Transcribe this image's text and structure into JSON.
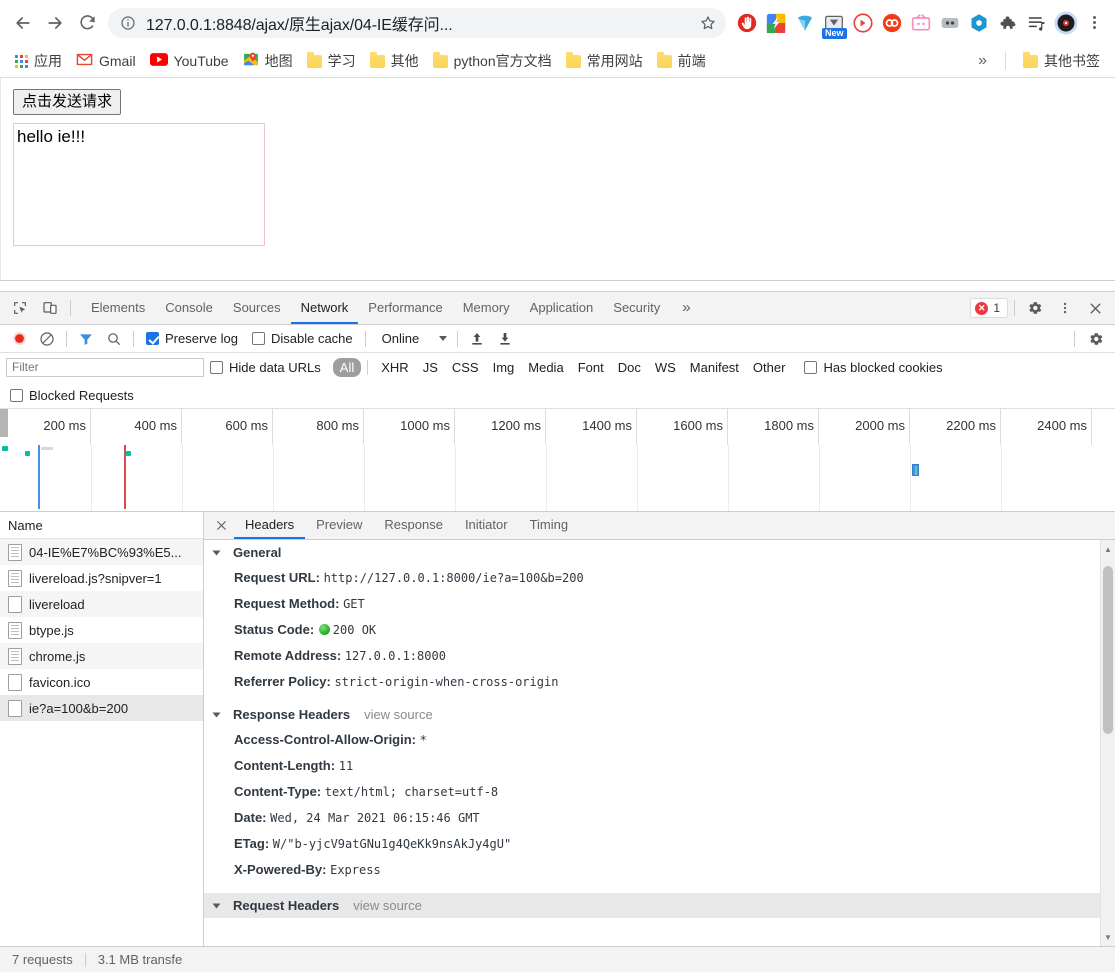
{
  "browser": {
    "url": "127.0.0.1:8848/ajax/原生ajax/04-IE缓存问...",
    "back_icon": "back-arrow-icon",
    "forward_icon": "forward-arrow-icon",
    "reload_icon": "reload-icon",
    "info_icon": "site-info-icon",
    "star_icon": "bookmark-star-icon",
    "menu_icon": "chrome-menu-icon",
    "extensions": [
      {
        "name": "adblock-extension-icon",
        "badge": ""
      },
      {
        "name": "screenshot-extension-icon",
        "badge": ""
      },
      {
        "name": "yandex-extension-icon",
        "badge": ""
      },
      {
        "name": "video-downloader-extension-icon",
        "badge": "New"
      },
      {
        "name": "media-player-extension-icon",
        "badge": ""
      },
      {
        "name": "infinity-newtab-extension-icon",
        "badge": ""
      },
      {
        "name": "tv-extension-icon",
        "badge": ""
      },
      {
        "name": "tampermonkey-extension-icon",
        "badge": ""
      },
      {
        "name": "octotree-extension-icon",
        "badge": ""
      },
      {
        "name": "puzzle-extensions-icon",
        "badge": ""
      },
      {
        "name": "playlist-extension-icon",
        "badge": ""
      },
      {
        "name": "music-extension-icon",
        "badge": ""
      }
    ]
  },
  "bookmarks": {
    "apps_label": "应用",
    "items": [
      {
        "label": "Gmail",
        "icon": "gmail-icon"
      },
      {
        "label": "YouTube",
        "icon": "youtube-icon"
      },
      {
        "label": "地图",
        "icon": "maps-icon"
      },
      {
        "label": "学习",
        "icon": "folder-icon"
      },
      {
        "label": "其他",
        "icon": "folder-icon"
      },
      {
        "label": "python官方文档",
        "icon": "folder-icon"
      },
      {
        "label": "常用网站",
        "icon": "folder-icon"
      },
      {
        "label": "前端",
        "icon": "folder-icon"
      }
    ],
    "overflow_label": "»",
    "other_bookmarks": "其他书签"
  },
  "page": {
    "button_label": "点击发送请求",
    "result_text": "hello ie!!!",
    "result_border_color": "#f3c3cd"
  },
  "devtools": {
    "tabs": [
      {
        "label": "Elements",
        "active": false
      },
      {
        "label": "Console",
        "active": false
      },
      {
        "label": "Sources",
        "active": false
      },
      {
        "label": "Network",
        "active": true
      },
      {
        "label": "Performance",
        "active": false
      },
      {
        "label": "Memory",
        "active": false
      },
      {
        "label": "Application",
        "active": false
      },
      {
        "label": "Security",
        "active": false
      }
    ],
    "more_tabs_label": "»",
    "inspect_icon": "inspect-element-icon",
    "device_icon": "device-toolbar-icon",
    "error_count": "1",
    "settings_icon": "gear-icon",
    "kebab_icon": "more-options-icon",
    "close_icon": "close-icon",
    "network_toolbar": {
      "record_icon": "record-button-icon",
      "clear_icon": "clear-icon",
      "filter_icon": "filter-icon",
      "search_icon": "search-icon",
      "preserve_log_label": "Preserve log",
      "preserve_log_checked": true,
      "disable_cache_label": "Disable cache",
      "disable_cache_checked": false,
      "throttle_value": "Online",
      "import_icon": "import-har-icon",
      "export_icon": "export-har-icon",
      "settings_icon": "network-settings-gear-icon"
    },
    "filter_row": {
      "filter_placeholder": "Filter",
      "filter_value": "",
      "hide_data_urls_label": "Hide data URLs",
      "hide_data_urls_checked": false,
      "types": [
        "All",
        "XHR",
        "JS",
        "CSS",
        "Img",
        "Media",
        "Font",
        "Doc",
        "WS",
        "Manifest",
        "Other"
      ],
      "active_type": "All",
      "has_blocked_cookies_label": "Has blocked cookies",
      "has_blocked_cookies_checked": false,
      "blocked_requests_label": "Blocked Requests",
      "blocked_requests_checked": false
    },
    "overview": {
      "ticks": [
        "200 ms",
        "400 ms",
        "600 ms",
        "800 ms",
        "1000 ms",
        "1200 ms",
        "1400 ms",
        "1600 ms",
        "1800 ms",
        "2000 ms",
        "2200 ms",
        "2400 ms"
      ],
      "dom_content_loaded_color": "#4a90e2",
      "load_event_color": "#d94b4b",
      "request_bar_color": "#00bfa5"
    },
    "requests": {
      "column_name": "Name",
      "rows": [
        {
          "name": "04-IE%E7%BC%93%E5...",
          "icon": "document-icon",
          "selected": false
        },
        {
          "name": "livereload.js?snipver=1",
          "icon": "script-icon",
          "selected": false
        },
        {
          "name": "livereload",
          "icon": "generic-icon",
          "selected": false
        },
        {
          "name": "btype.js",
          "icon": "script-icon",
          "selected": false
        },
        {
          "name": "chrome.js",
          "icon": "script-icon",
          "selected": false
        },
        {
          "name": "favicon.ico",
          "icon": "generic-icon",
          "selected": false
        },
        {
          "name": "ie?a=100&b=200",
          "icon": "generic-icon",
          "selected": true
        }
      ]
    },
    "details": {
      "close_icon": "close-details-icon",
      "tabs": [
        {
          "label": "Headers",
          "active": true
        },
        {
          "label": "Preview",
          "active": false
        },
        {
          "label": "Response",
          "active": false
        },
        {
          "label": "Initiator",
          "active": false
        },
        {
          "label": "Timing",
          "active": false
        }
      ],
      "general": {
        "title": "General",
        "rows": [
          {
            "key": "Request URL:",
            "value": "http://127.0.0.1:8000/ie?a=100&b=200",
            "dot": false
          },
          {
            "key": "Request Method:",
            "value": "GET",
            "dot": false
          },
          {
            "key": "Status Code:",
            "value": "200 OK",
            "dot": true
          },
          {
            "key": "Remote Address:",
            "value": "127.0.0.1:8000",
            "dot": false
          },
          {
            "key": "Referrer Policy:",
            "value": "strict-origin-when-cross-origin",
            "dot": false
          }
        ]
      },
      "response_headers": {
        "title": "Response Headers",
        "view_source": "view source",
        "rows": [
          {
            "key": "Access-Control-Allow-Origin:",
            "value": "*"
          },
          {
            "key": "Content-Length:",
            "value": "11"
          },
          {
            "key": "Content-Type:",
            "value": "text/html; charset=utf-8"
          },
          {
            "key": "Date:",
            "value": "Wed, 24 Mar 2021 06:15:46 GMT"
          },
          {
            "key": "ETag:",
            "value": "W/\"b-yjcV9atGNu1g4QeKk9nsAkJy4gU\""
          },
          {
            "key": "X-Powered-By:",
            "value": "Express"
          }
        ]
      },
      "request_headers": {
        "title": "Request Headers",
        "view_source": "view source"
      }
    },
    "statusbar": {
      "requests": "7 requests",
      "transferred": "3.1 MB transfe"
    }
  }
}
